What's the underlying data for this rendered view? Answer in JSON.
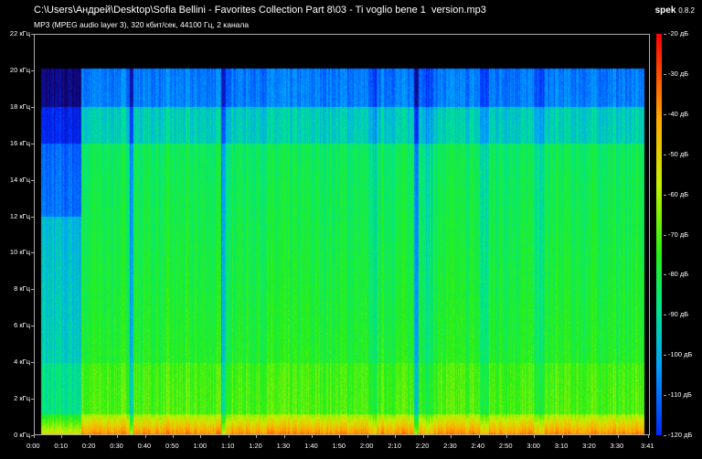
{
  "header": {
    "file_path": "C:\\Users\\Андрей\\Desktop\\Sofia Bellini - Favorites Collection Part 8\\03 - Ti voglio bene 1  version.mp3",
    "stream_info": "MP3 (MPEG audio layer 3), 320 кбит/сек, 44100 Гц, 2 канала",
    "app_name": "spek",
    "app_version": "0.8.2"
  },
  "freq_axis": {
    "labels": [
      "0 кГц",
      "2 кГц",
      "4 кГц",
      "6 кГц",
      "8 кГц",
      "10 кГц",
      "12 кГц",
      "14 кГц",
      "16 кГц",
      "18 кГц",
      "20 кГц",
      "22 кГц"
    ],
    "max_khz": 22
  },
  "time_axis": {
    "labels": [
      "0:00",
      "0:10",
      "0:20",
      "0:30",
      "0:40",
      "0:50",
      "1:00",
      "1:10",
      "1:20",
      "1:30",
      "1:40",
      "1:50",
      "2:00",
      "2:10",
      "2:20",
      "2:30",
      "2:40",
      "2:50",
      "3:00",
      "3:10",
      "3:20",
      "3:30",
      "3:41"
    ],
    "duration_s": 221
  },
  "db_scale": {
    "labels": [
      "-20 дБ",
      "-30 дБ",
      "-40 дБ",
      "-50 дБ",
      "-60 дБ",
      "-70 дБ",
      "-80 дБ",
      "-90 дБ",
      "-100 дБ",
      "-110 дБ",
      "-120 дБ"
    ]
  },
  "colors": {
    "frame": "#aaaaaa",
    "background": "#000000"
  }
}
